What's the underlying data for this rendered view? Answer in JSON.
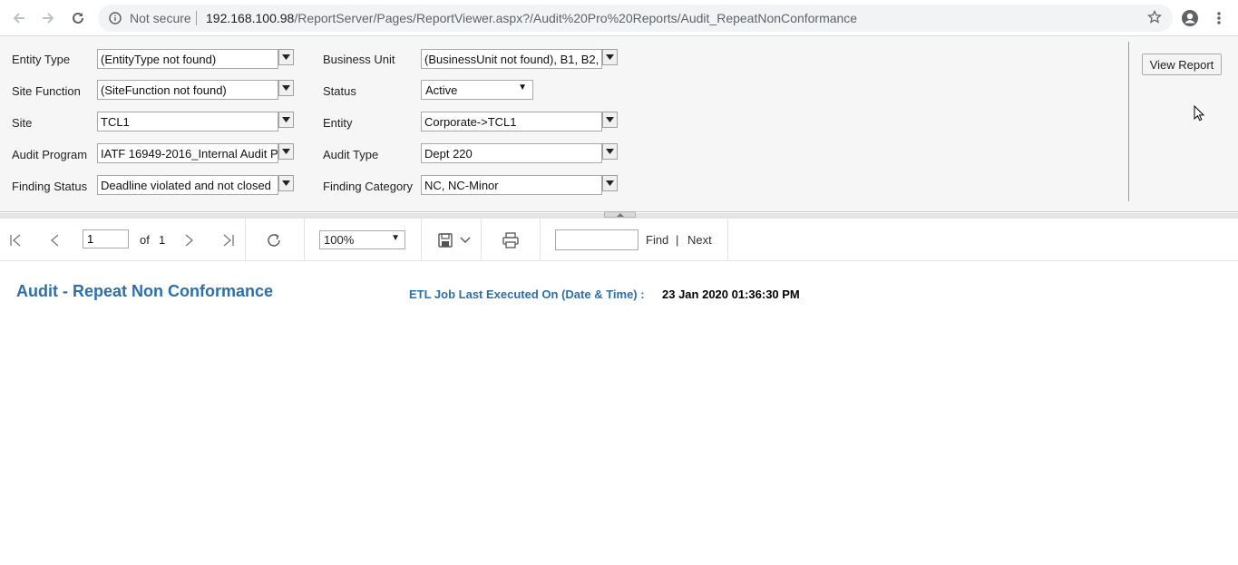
{
  "browser": {
    "security_label": "Not secure",
    "url_host": "192.168.100.98",
    "url_path": "/ReportServer/Pages/ReportViewer.aspx?/Audit%20Pro%20Reports/Audit_RepeatNonConformance"
  },
  "parameters": {
    "entity_type": {
      "label": "Entity Type",
      "value": "(EntityType not found)"
    },
    "business_unit": {
      "label": "Business Unit",
      "value": "(BusinessUnit not found), B1, B2, B"
    },
    "site_function": {
      "label": "Site Function",
      "value": "(SiteFunction not found)"
    },
    "status": {
      "label": "Status",
      "value": "Active"
    },
    "site": {
      "label": "Site",
      "value": "TCL1"
    },
    "entity": {
      "label": "Entity",
      "value": "Corporate->TCL1"
    },
    "audit_program": {
      "label": "Audit Program",
      "value": "IATF 16949-2016_Internal Audit P"
    },
    "audit_type": {
      "label": "Audit Type",
      "value": "Dept 220"
    },
    "finding_status": {
      "label": "Finding Status",
      "value": "Deadline violated and not closed"
    },
    "finding_category": {
      "label": "Finding Category",
      "value": "NC, NC-Minor"
    },
    "view_report_label": "View Report"
  },
  "toolbar": {
    "current_page": "1",
    "of_label": "of",
    "total_pages": "1",
    "zoom": "100%",
    "find_label": "Find",
    "separator": "|",
    "next_label": "Next"
  },
  "report": {
    "title": "Audit - Repeat Non Conformance",
    "etl_label": "ETL Job Last Executed On (Date & Time) :",
    "etl_value": "23 Jan 2020 01:36:30 PM"
  },
  "colors": {
    "report_title": "#2d6fa6",
    "param_background": "#f6f6f6"
  }
}
